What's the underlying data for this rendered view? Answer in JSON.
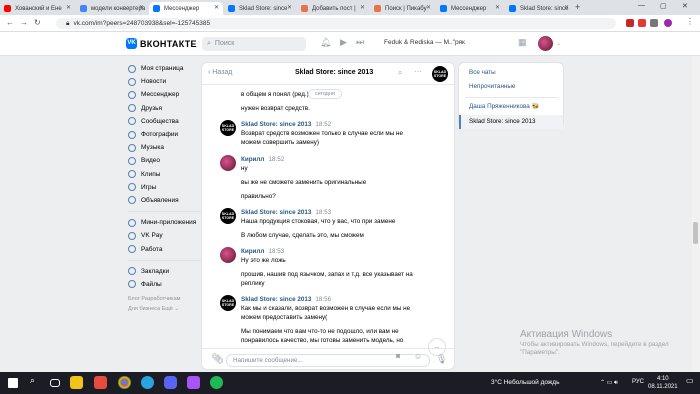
{
  "browser": {
    "tabs": [
      {
        "title": "Хованский и Ене",
        "color": "#ff0000"
      },
      {
        "title": "модели конвертера",
        "color": "#4285f4"
      },
      {
        "title": "Мессенджер",
        "color": "#0077ff"
      },
      {
        "title": "Sklad Store: since",
        "color": "#0077ff"
      },
      {
        "title": "Добавить пост |",
        "color": "#e8734a"
      },
      {
        "title": "Поиск | Пикабу",
        "color": "#e8734a"
      },
      {
        "title": "Мессенджер",
        "color": "#0077ff"
      },
      {
        "title": "Sklad Store: since",
        "color": "#0077ff"
      }
    ],
    "new_tab": "+",
    "url": "vk.com/im?peers=248703938&sel=-125745385"
  },
  "vk_header": {
    "logo": "ВКОНТАКТЕ",
    "logo_mark": "VK",
    "search_placeholder": "Поиск",
    "now_playing": "Feduk & Rediska — М..\"ряк"
  },
  "sidebar": {
    "items": [
      {
        "label": "Моя страница"
      },
      {
        "label": "Новости"
      },
      {
        "label": "Мессенджер"
      },
      {
        "label": "Друзья"
      },
      {
        "label": "Сообщества"
      },
      {
        "label": "Фотографии"
      },
      {
        "label": "Музыка"
      },
      {
        "label": "Видео"
      },
      {
        "label": "Клипы"
      },
      {
        "label": "Игры"
      },
      {
        "label": "Объявления"
      }
    ],
    "items2": [
      {
        "label": "Мини-приложения"
      },
      {
        "label": "VK Pay"
      },
      {
        "label": "Работа"
      }
    ],
    "items3": [
      {
        "label": "Закладки"
      },
      {
        "label": "Файлы"
      }
    ],
    "footer": {
      "line1": "Блог  Разработчикам",
      "line2": "Для бизнеса  Ещё ⌄"
    }
  },
  "chat": {
    "back": "Назад",
    "title": "Sklad Store: since 2013",
    "store_avatar": "SKLAD STORE",
    "messages": {
      "m0a": "в общем я понял (ред.)",
      "pill": "сегодня",
      "m0b": "нужен возврат средств.",
      "n1": "Sklad Store: since 2013",
      "t1": "18:52",
      "m1a": "Возврат средств возможен только в случае если мы не",
      "m1b": "можем совершить замену)",
      "n2": "Кирилл",
      "t2": "18:52",
      "m2a": "ну",
      "m2b": "вы же не сможете заменить оригинальные",
      "m2c": "правильно?",
      "n3": "Sklad Store: since 2013",
      "t3": "18:53",
      "m3a": "Наша продукция стоковая, что у вас, что при замене",
      "m3b": "В любом случае, сделать это, мы сможем",
      "n4": "Кирилл",
      "t4": "18:53",
      "m4a": "Ну это же ложь",
      "m4b": "прошив, нашив под язычком, запах и т.д. все указывает на",
      "m4c": "реплику",
      "n5": "Sklad Store: since 2013",
      "t5": "18:56",
      "m5a": "Как мы и сказали, возврат возможен в случае если мы не",
      "m5b": "можем предоставить замену(",
      "m5c": "Мы понимаем что вам что-то не подошло, или вам не",
      "m5d": "понравилось качество, мы готовы заменить модель, но"
    },
    "compose_placeholder": "Напишите сообщение..."
  },
  "right_panel": {
    "all_chats": "Все чаты",
    "unread": "Непрочитанные",
    "dialog1": "Даша Пряженникова 🐝",
    "dialog2": "Sklad Store: since 2013"
  },
  "watermark": {
    "title": "Активация Windows",
    "line1": "Чтобы активировать Windows, перейдите в раздел",
    "line2": "\"Параметры\"."
  },
  "taskbar": {
    "weather": "3°C  Небольшой дождь",
    "lang": "РУС",
    "time": "4:10",
    "date": "08.11.2021"
  }
}
